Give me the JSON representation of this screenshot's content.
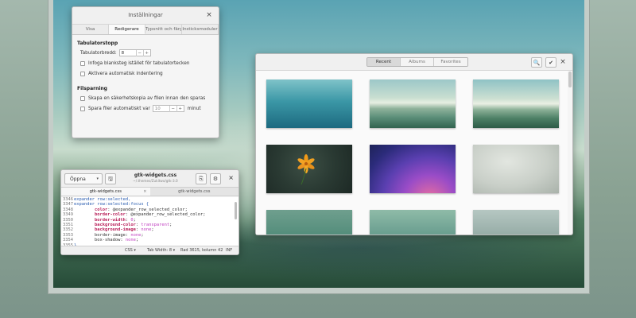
{
  "prefs": {
    "title": "Inställningar",
    "close": "×",
    "tabs": [
      "Visa",
      "Redigerare",
      "Typsnitt och färger",
      "Insticksmoduler"
    ],
    "section_tab_stops": "Tabulatorstopp",
    "tab_width_label": "Tabulatorbredd:",
    "tab_width_value": "8",
    "insert_spaces": "Infoga blanksteg istället för tabulatortecken",
    "auto_indent": "Aktivera automatisk indentering",
    "section_saving": "Filsparning",
    "backup_copy": "Skapa en säkerhetskopia av filen innan den sparas",
    "autosave_label": "Spara filer automatiskt var",
    "autosave_value": "10",
    "autosave_unit": "minut",
    "spin_minus": "−",
    "spin_plus": "+"
  },
  "picker": {
    "segments": [
      "Recent",
      "Albums",
      "Favorites"
    ],
    "search_glyph": "🔍",
    "check_glyph": "✔",
    "close": "×"
  },
  "gedit": {
    "open_label": "Öppna",
    "open_caret": "▾",
    "save_glyph": "🖫",
    "title": "gtk-widgets.css",
    "subtitle": "~/.themes/Zukitwo/gtk-3.0",
    "find_glyph": "⎘",
    "gear_glyph": "⚙",
    "close": "×",
    "tabs": [
      {
        "label": "gtk-widgets.css",
        "close": "×"
      },
      {
        "label": "gtk-widgets.css"
      }
    ],
    "lines": [
      {
        "n": "3346",
        "parts": [
          {
            "c": "kw1",
            "t": "expander row:selected,"
          }
        ]
      },
      {
        "n": "3347",
        "parts": [
          {
            "c": "kw1",
            "t": "expander row:selected:focus {"
          }
        ]
      },
      {
        "n": "3348",
        "parts": [
          {
            "c": "tx",
            "t": "        "
          },
          {
            "c": "kw2",
            "t": "color"
          },
          {
            "c": "tx",
            "t": ": @expander_row_selected_color;"
          }
        ]
      },
      {
        "n": "3349",
        "parts": [
          {
            "c": "tx",
            "t": "        "
          },
          {
            "c": "kw2",
            "t": "border-color"
          },
          {
            "c": "tx",
            "t": ": @expander_row_selected_color;"
          }
        ]
      },
      {
        "n": "3350",
        "parts": [
          {
            "c": "tx",
            "t": "        "
          },
          {
            "c": "kw2",
            "t": "border-width"
          },
          {
            "c": "tx",
            "t": ": "
          },
          {
            "c": "kw3",
            "t": "0"
          },
          {
            "c": "tx",
            "t": ";"
          }
        ]
      },
      {
        "n": "3351",
        "parts": [
          {
            "c": "tx",
            "t": "        "
          },
          {
            "c": "kw2",
            "t": "background-color"
          },
          {
            "c": "tx",
            "t": ": "
          },
          {
            "c": "kw3",
            "t": "transparent"
          },
          {
            "c": "tx",
            "t": ";"
          }
        ]
      },
      {
        "n": "3352",
        "parts": [
          {
            "c": "tx",
            "t": "        "
          },
          {
            "c": "kw2",
            "t": "background-image"
          },
          {
            "c": "tx",
            "t": ": "
          },
          {
            "c": "kw3",
            "t": "none"
          },
          {
            "c": "tx",
            "t": ";"
          }
        ]
      },
      {
        "n": "3353",
        "parts": [
          {
            "c": "tx",
            "t": "        border-image: "
          },
          {
            "c": "kw3",
            "t": "none"
          },
          {
            "c": "tx",
            "t": ";"
          }
        ]
      },
      {
        "n": "3354",
        "parts": [
          {
            "c": "tx",
            "t": "        box-shadow: "
          },
          {
            "c": "kw3",
            "t": "none"
          },
          {
            "c": "tx",
            "t": ";"
          }
        ]
      },
      {
        "n": "3355",
        "parts": [
          {
            "c": "kw1",
            "t": "}"
          }
        ]
      }
    ],
    "status_lang": "CSS ▾",
    "status_tab": "Tab Width: 8 ▾",
    "status_pos": "Rad 3615, kolumn 42",
    "status_mode": "INF"
  }
}
